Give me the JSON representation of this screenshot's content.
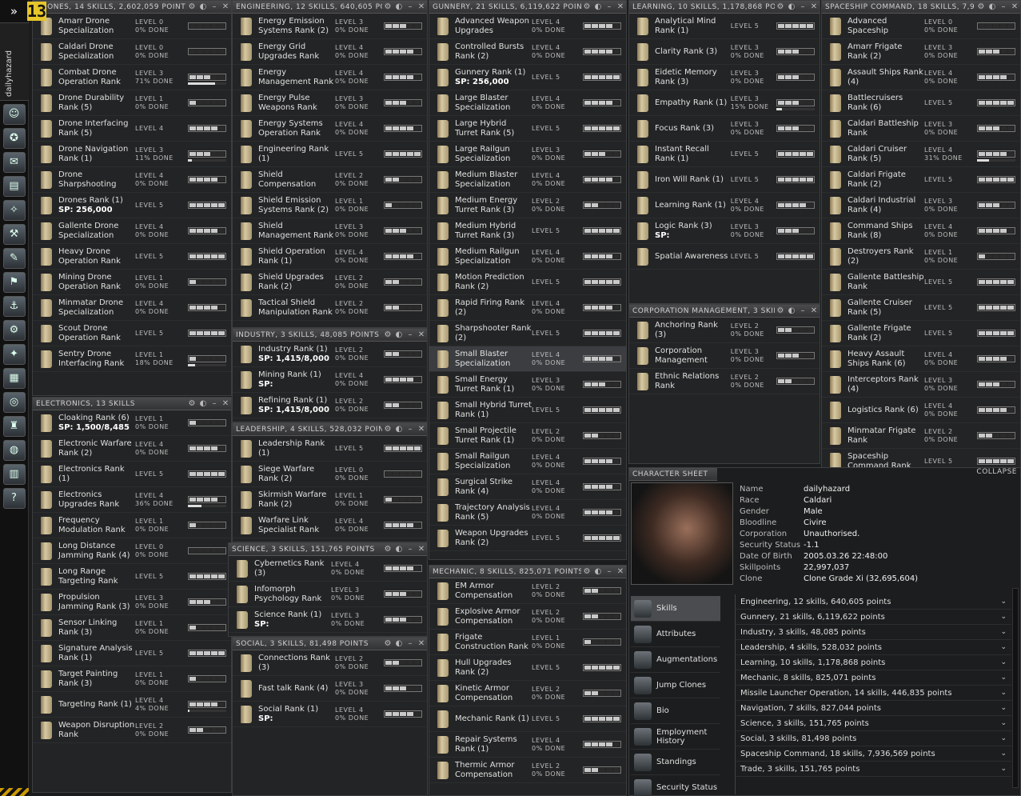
{
  "badge": "13",
  "sidebar": {
    "expand": "»",
    "char": "dailyhazard",
    "icons": [
      "person-icon",
      "neocom-icon",
      "mail-icon",
      "notepad-icon",
      "map-icon",
      "market-icon",
      "journal-icon",
      "corp-icon",
      "fleet-icon",
      "industry-icon",
      "skills-icon",
      "calculator-icon",
      "help-ring-icon",
      "dungeon-icon",
      "browser-icon",
      "book-icon",
      "help-icon"
    ]
  },
  "windows": [
    {
      "title": "DRONES, 14 SKILLS, 2,602,059 POINTS",
      "skills": [
        [
          "Amarr Drone Specialization",
          "LEVEL 0",
          "0% DONE",
          0,
          0,
          ""
        ],
        [
          "Caldari Drone Specialization",
          "LEVEL 0",
          "0% DONE",
          0,
          0,
          ""
        ],
        [
          "Combat Drone Operation Rank",
          "LEVEL 3",
          "71% DONE",
          3,
          71,
          ""
        ],
        [
          "Drone Durability Rank (5)",
          "LEVEL 1",
          "0% DONE",
          1,
          0,
          ""
        ],
        [
          "Drone Interfacing Rank (5)",
          "LEVEL 4",
          "",
          4,
          0,
          ""
        ],
        [
          "Drone Navigation Rank (1)",
          "LEVEL 3",
          "11% DONE",
          3,
          11,
          ""
        ],
        [
          "Drone Sharpshooting",
          "LEVEL 4",
          "0% DONE",
          4,
          0,
          ""
        ],
        [
          "Drones Rank (1)",
          "LEVEL 5",
          "",
          5,
          0,
          "SP: 256,000"
        ],
        [
          "Gallente Drone Specialization",
          "LEVEL 4",
          "0% DONE",
          4,
          0,
          ""
        ],
        [
          "Heavy Drone Operation Rank",
          "LEVEL 5",
          "",
          5,
          0,
          ""
        ],
        [
          "Mining Drone Operation Rank",
          "LEVEL 1",
          "0% DONE",
          1,
          0,
          ""
        ],
        [
          "Minmatar Drone Specialization",
          "LEVEL 4",
          "0% DONE",
          4,
          0,
          ""
        ],
        [
          "Scout Drone Operation Rank",
          "LEVEL 5",
          "",
          5,
          0,
          ""
        ],
        [
          "Sentry Drone Interfacing Rank",
          "LEVEL 1",
          "18% DONE",
          1,
          18,
          ""
        ]
      ]
    },
    {
      "title": "ELECTRONICS, 13 SKILLS",
      "skills": [
        [
          "Cloaking Rank (6)",
          "LEVEL 1",
          "0% DONE",
          1,
          0,
          "SP: 1,500/8,485"
        ],
        [
          "Electronic Warfare Rank (2)",
          "LEVEL 4",
          "0% DONE",
          4,
          0,
          ""
        ],
        [
          "Electronics Rank (1)",
          "LEVEL 5",
          "",
          5,
          0,
          ""
        ],
        [
          "Electronics Upgrades Rank",
          "LEVEL 4",
          "36% DONE",
          4,
          36,
          ""
        ],
        [
          "Frequency Modulation Rank",
          "LEVEL 1",
          "0% DONE",
          1,
          0,
          ""
        ],
        [
          "Long Distance Jamming Rank (4)",
          "LEVEL 0",
          "0% DONE",
          0,
          0,
          ""
        ],
        [
          "Long Range Targeting Rank",
          "LEVEL 5",
          "",
          5,
          0,
          ""
        ],
        [
          "Propulsion Jamming Rank (3)",
          "LEVEL 3",
          "0% DONE",
          3,
          0,
          ""
        ],
        [
          "Sensor Linking Rank (3)",
          "LEVEL 1",
          "0% DONE",
          1,
          0,
          ""
        ],
        [
          "Signature Analysis Rank (1)",
          "LEVEL 5",
          "",
          5,
          0,
          ""
        ],
        [
          "Target Painting Rank (3)",
          "LEVEL 1",
          "0% DONE",
          1,
          0,
          ""
        ],
        [
          "Targeting Rank (1)",
          "LEVEL 4",
          "4% DONE",
          4,
          4,
          ""
        ],
        [
          "Weapon Disruption Rank",
          "LEVEL 2",
          "0% DONE",
          2,
          0,
          ""
        ]
      ]
    },
    {
      "title": "ENGINEERING, 12 SKILLS, 640,605 POINTS",
      "skills": [
        [
          "Energy Emission Systems Rank (2)",
          "LEVEL 3",
          "0% DONE",
          3,
          0,
          ""
        ],
        [
          "Energy Grid Upgrades Rank",
          "LEVEL 4",
          "0% DONE",
          4,
          0,
          ""
        ],
        [
          "Energy Management Rank",
          "LEVEL 4",
          "0% DONE",
          4,
          0,
          ""
        ],
        [
          "Energy Pulse Weapons Rank",
          "LEVEL 3",
          "0% DONE",
          3,
          0,
          ""
        ],
        [
          "Energy Systems Operation Rank",
          "LEVEL 4",
          "0% DONE",
          4,
          0,
          ""
        ],
        [
          "Engineering Rank (1)",
          "LEVEL 5",
          "",
          5,
          0,
          ""
        ],
        [
          "Shield Compensation",
          "LEVEL 2",
          "0% DONE",
          2,
          0,
          ""
        ],
        [
          "Shield Emission Systems Rank (2)",
          "LEVEL 1",
          "0% DONE",
          1,
          0,
          ""
        ],
        [
          "Shield Management Rank",
          "LEVEL 3",
          "0% DONE",
          3,
          0,
          ""
        ],
        [
          "Shield Operation Rank (1)",
          "LEVEL 4",
          "0% DONE",
          4,
          0,
          ""
        ],
        [
          "Shield Upgrades Rank (2)",
          "LEVEL 2",
          "0% DONE",
          2,
          0,
          ""
        ],
        [
          "Tactical Shield Manipulation Rank",
          "LEVEL 2",
          "0% DONE",
          2,
          0,
          ""
        ]
      ]
    },
    {
      "title": "INDUSTRY, 3 SKILLS, 48,085 POINTS",
      "skills": [
        [
          "Industry Rank (1)",
          "LEVEL 2",
          "0% DONE",
          2,
          0,
          "SP: 1,415/8,000"
        ],
        [
          "Mining Rank (1)",
          "LEVEL 4",
          "0% DONE",
          4,
          0,
          "SP:"
        ],
        [
          "Refining Rank (1)",
          "LEVEL 2",
          "0% DONE",
          2,
          0,
          "SP: 1,415/8,000"
        ]
      ]
    },
    {
      "title": "LEADERSHIP, 4 SKILLS, 528,032 POINTS",
      "skills": [
        [
          "Leadership Rank (1)",
          "LEVEL 5",
          "",
          5,
          0,
          ""
        ],
        [
          "Siege Warfare Rank (2)",
          "LEVEL 0",
          "0% DONE",
          0,
          0,
          ""
        ],
        [
          "Skirmish Warfare Rank (2)",
          "LEVEL 1",
          "0% DONE",
          1,
          0,
          ""
        ],
        [
          "Warfare Link Specialist Rank",
          "LEVEL 4",
          "0% DONE",
          4,
          0,
          ""
        ]
      ]
    },
    {
      "title": "SCIENCE, 3 SKILLS, 151,765 POINTS",
      "skills": [
        [
          "Cybernetics Rank (3)",
          "LEVEL 4",
          "0% DONE",
          4,
          0,
          ""
        ],
        [
          "Infomorph Psychology Rank",
          "LEVEL 3",
          "0% DONE",
          3,
          0,
          ""
        ],
        [
          "Science Rank (1)",
          "LEVEL 3",
          "0% DONE",
          3,
          0,
          "SP:"
        ]
      ]
    },
    {
      "title": "SOCIAL, 3 SKILLS, 81,498 POINTS",
      "skills": [
        [
          "Connections Rank (3)",
          "LEVEL 2",
          "0% DONE",
          2,
          0,
          ""
        ],
        [
          "Fast talk Rank (4)",
          "LEVEL 3",
          "0% DONE",
          3,
          0,
          ""
        ],
        [
          "Social Rank (1)",
          "LEVEL 4",
          "0% DONE",
          4,
          0,
          "SP:"
        ]
      ]
    },
    {
      "title": "GUNNERY, 21 SKILLS, 6,119,622 POINTS",
      "skills": [
        [
          "Advanced Weapon Upgrades",
          "LEVEL 4",
          "0% DONE",
          4,
          0,
          ""
        ],
        [
          "Controlled Bursts Rank (2)",
          "LEVEL 4",
          "0% DONE",
          4,
          0,
          ""
        ],
        [
          "Gunnery Rank (1)",
          "LEVEL 5",
          "",
          5,
          0,
          "SP: 256,000"
        ],
        [
          "Large Blaster Specialization",
          "LEVEL 4",
          "0% DONE",
          4,
          0,
          ""
        ],
        [
          "Large Hybrid Turret Rank (5)",
          "LEVEL 5",
          "",
          5,
          0,
          ""
        ],
        [
          "Large Railgun Specialization",
          "LEVEL 3",
          "0% DONE",
          3,
          0,
          ""
        ],
        [
          "Medium Blaster Specialization",
          "LEVEL 4",
          "0% DONE",
          4,
          0,
          ""
        ],
        [
          "Medium Energy Turret Rank (3)",
          "LEVEL 2",
          "0% DONE",
          2,
          0,
          ""
        ],
        [
          "Medium Hybrid Turret Rank (3)",
          "LEVEL 5",
          "",
          5,
          0,
          ""
        ],
        [
          "Medium Railgun Specialization",
          "LEVEL 4",
          "0% DONE",
          4,
          0,
          ""
        ],
        [
          "Motion Prediction Rank (2)",
          "LEVEL 5",
          "",
          5,
          0,
          ""
        ],
        [
          "Rapid Firing Rank (2)",
          "LEVEL 4",
          "0% DONE",
          4,
          0,
          ""
        ],
        [
          "Sharpshooter Rank (2)",
          "LEVEL 5",
          "",
          5,
          0,
          ""
        ],
        [
          "Small Blaster Specialization",
          "LEVEL 4",
          "0% DONE",
          4,
          0,
          ""
        ],
        [
          "Small Energy Turret Rank (1)",
          "LEVEL 3",
          "0% DONE",
          3,
          0,
          ""
        ],
        [
          "Small Hybrid Turret Rank (1)",
          "LEVEL 5",
          "",
          5,
          0,
          ""
        ],
        [
          "Small Projectile Turret Rank (1)",
          "LEVEL 2",
          "0% DONE",
          2,
          0,
          ""
        ],
        [
          "Small Railgun Specialization",
          "LEVEL 4",
          "0% DONE",
          4,
          0,
          ""
        ],
        [
          "Surgical Strike Rank (4)",
          "LEVEL 4",
          "0% DONE",
          4,
          0,
          ""
        ],
        [
          "Trajectory Analysis Rank (5)",
          "LEVEL 4",
          "0% DONE",
          4,
          0,
          ""
        ],
        [
          "Weapon Upgrades Rank (2)",
          "LEVEL 5",
          "",
          5,
          0,
          ""
        ]
      ]
    },
    {
      "title": "MECHANIC, 8 SKILLS, 825,071 POINTS",
      "skills": [
        [
          "EM Armor Compensation",
          "LEVEL 2",
          "0% DONE",
          2,
          0,
          ""
        ],
        [
          "Explosive Armor Compensation",
          "LEVEL 2",
          "0% DONE",
          2,
          0,
          ""
        ],
        [
          "Frigate Construction Rank",
          "LEVEL 1",
          "0% DONE",
          1,
          0,
          ""
        ],
        [
          "Hull Upgrades Rank (2)",
          "LEVEL 5",
          "",
          5,
          0,
          ""
        ],
        [
          "Kinetic Armor Compensation",
          "LEVEL 2",
          "0% DONE",
          2,
          0,
          ""
        ],
        [
          "Mechanic Rank (1)",
          "LEVEL 5",
          "",
          5,
          0,
          ""
        ],
        [
          "Repair Systems Rank (1)",
          "LEVEL 4",
          "0% DONE",
          4,
          0,
          ""
        ],
        [
          "Thermic Armor Compensation",
          "LEVEL 2",
          "0% DONE",
          2,
          0,
          ""
        ]
      ]
    },
    {
      "title": "LEARNING, 10 SKILLS, 1,178,868 POINTS",
      "skills": [
        [
          "Analytical Mind Rank (1)",
          "LEVEL 5",
          "",
          5,
          0,
          ""
        ],
        [
          "Clarity Rank (3)",
          "LEVEL 3",
          "0% DONE",
          3,
          0,
          ""
        ],
        [
          "Eidetic Memory Rank (3)",
          "LEVEL 3",
          "0% DONE",
          3,
          0,
          ""
        ],
        [
          "Empathy Rank (1)",
          "LEVEL 3",
          "15% DONE",
          3,
          15,
          ""
        ],
        [
          "Focus Rank (3)",
          "LEVEL 3",
          "0% DONE",
          3,
          0,
          ""
        ],
        [
          "Instant Recall Rank (1)",
          "LEVEL 5",
          "",
          5,
          0,
          ""
        ],
        [
          "Iron Will Rank (1)",
          "LEVEL 5",
          "",
          5,
          0,
          ""
        ],
        [
          "Learning Rank (1)",
          "LEVEL 4",
          "0% DONE",
          4,
          0,
          ""
        ],
        [
          "Logic Rank (3)",
          "LEVEL 3",
          "0% DONE",
          3,
          0,
          "SP:"
        ],
        [
          "Spatial Awareness",
          "LEVEL 5",
          "",
          5,
          0,
          ""
        ]
      ]
    },
    {
      "title": "CORPORATION MANAGEMENT, 3 SKILLS",
      "skills": [
        [
          "Anchoring Rank (3)",
          "LEVEL 2",
          "0% DONE",
          2,
          0,
          ""
        ],
        [
          "Corporation Management",
          "LEVEL 3",
          "0% DONE",
          3,
          0,
          ""
        ],
        [
          "Ethnic Relations Rank",
          "LEVEL 2",
          "0% DONE",
          2,
          0,
          ""
        ]
      ]
    },
    {
      "title": "SPACESHIP COMMAND, 18 SKILLS, 7,9",
      "skills": [
        [
          "Advanced Spaceship",
          "LEVEL 0",
          "0% DONE",
          0,
          0,
          ""
        ],
        [
          "Amarr Frigate Rank (2)",
          "LEVEL 3",
          "0% DONE",
          3,
          0,
          ""
        ],
        [
          "Assault Ships Rank (4)",
          "LEVEL 4",
          "0% DONE",
          4,
          0,
          ""
        ],
        [
          "Battlecruisers Rank (6)",
          "LEVEL 5",
          "",
          5,
          0,
          ""
        ],
        [
          "Caldari Battleship Rank",
          "LEVEL 3",
          "0% DONE",
          3,
          0,
          ""
        ],
        [
          "Caldari Cruiser Rank (5)",
          "LEVEL 4",
          "31% DONE",
          4,
          31,
          ""
        ],
        [
          "Caldari Frigate Rank (2)",
          "LEVEL 5",
          "",
          5,
          0,
          ""
        ],
        [
          "Caldari Industrial Rank (4)",
          "LEVEL 3",
          "0% DONE",
          3,
          0,
          ""
        ],
        [
          "Command Ships Rank (8)",
          "LEVEL 4",
          "0% DONE",
          4,
          0,
          ""
        ],
        [
          "Destroyers Rank (2)",
          "LEVEL 1",
          "0% DONE",
          1,
          0,
          ""
        ],
        [
          "Gallente Battleship Rank",
          "LEVEL 5",
          "",
          5,
          0,
          ""
        ],
        [
          "Gallente Cruiser Rank (5)",
          "LEVEL 5",
          "",
          5,
          0,
          ""
        ],
        [
          "Gallente Frigate Rank (2)",
          "LEVEL 5",
          "",
          5,
          0,
          ""
        ],
        [
          "Heavy Assault Ships Rank (6)",
          "LEVEL 4",
          "0% DONE",
          4,
          0,
          ""
        ],
        [
          "Interceptors Rank (4)",
          "LEVEL 3",
          "0% DONE",
          3,
          0,
          ""
        ],
        [
          "Logistics Rank (6)",
          "LEVEL 4",
          "0% DONE",
          4,
          0,
          ""
        ],
        [
          "Minmatar Frigate Rank",
          "LEVEL 2",
          "0% DONE",
          2,
          0,
          ""
        ],
        [
          "Spaceship Command Rank",
          "LEVEL 5",
          "",
          5,
          0,
          ""
        ]
      ]
    }
  ],
  "charsheet": {
    "title": "CHARACTER SHEET",
    "collapse": "COLLAPSE",
    "fields": [
      [
        "Name",
        "dailyhazard"
      ],
      [
        "Race",
        "Caldari"
      ],
      [
        "Gender",
        "Male"
      ],
      [
        "Bloodline",
        "Civire"
      ],
      [
        "Corporation",
        "Unauthorised."
      ],
      [
        "Security Status",
        "-1.1"
      ],
      [
        "Date Of Birth",
        "2005.03.26 22:48:00"
      ],
      [
        "Skillpoints",
        "22,997,037"
      ],
      [
        "Clone",
        "Clone Grade Xi (32,695,604)"
      ]
    ],
    "menu": [
      "Skills",
      "Attributes",
      "Augmentations",
      "Jump Clones",
      "Bio",
      "Employment History",
      "Standings",
      "Security Status"
    ],
    "groups": [
      "Engineering, 12 skills, 640,605 points",
      "Gunnery, 21 skills, 6,119,622 points",
      "Industry, 3 skills, 48,085 points",
      "Leadership, 4 skills, 528,032 points",
      "Learning, 10 skills, 1,178,868 points",
      "Mechanic, 8 skills, 825,071 points",
      "Missile Launcher Operation, 14 skills, 446,835 points",
      "Navigation, 7 skills, 827,044 points",
      "Science, 3 skills, 151,765 points",
      "Social, 3 skills, 81,498 points",
      "Spaceship Command, 18 skills, 7,936,569 points",
      "Trade, 3 skills, 151,765 points"
    ]
  }
}
